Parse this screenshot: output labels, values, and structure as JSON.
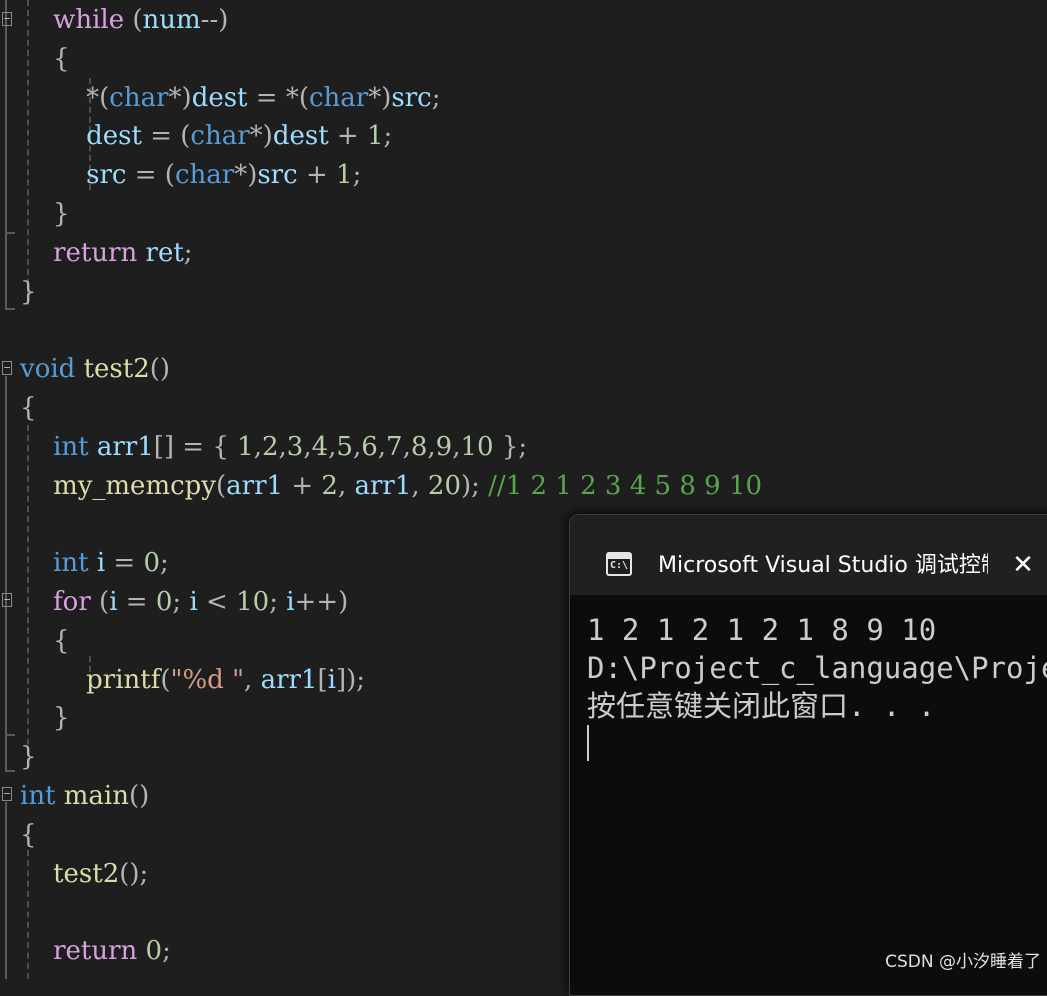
{
  "editor": {
    "lines": [
      [
        {
          "t": "    ",
          "c": "txt"
        },
        {
          "t": "while",
          "c": "ctl"
        },
        {
          "t": " (",
          "c": "pun"
        },
        {
          "t": "num",
          "c": "var"
        },
        {
          "t": "--)",
          "c": "pun"
        }
      ],
      [
        {
          "t": "    {",
          "c": "pun"
        }
      ],
      [
        {
          "t": "        ",
          "c": "txt"
        },
        {
          "t": "*(",
          "c": "pun"
        },
        {
          "t": "char",
          "c": "kw"
        },
        {
          "t": "*)",
          "c": "pun"
        },
        {
          "t": "dest",
          "c": "var"
        },
        {
          "t": " = ",
          "c": "pun"
        },
        {
          "t": "*(",
          "c": "pun"
        },
        {
          "t": "char",
          "c": "kw"
        },
        {
          "t": "*)",
          "c": "pun"
        },
        {
          "t": "src",
          "c": "var"
        },
        {
          "t": ";",
          "c": "pun"
        }
      ],
      [
        {
          "t": "        ",
          "c": "txt"
        },
        {
          "t": "dest",
          "c": "var"
        },
        {
          "t": " = (",
          "c": "pun"
        },
        {
          "t": "char",
          "c": "kw"
        },
        {
          "t": "*)",
          "c": "pun"
        },
        {
          "t": "dest",
          "c": "var"
        },
        {
          "t": " + ",
          "c": "pun"
        },
        {
          "t": "1",
          "c": "num"
        },
        {
          "t": ";",
          "c": "pun"
        }
      ],
      [
        {
          "t": "        ",
          "c": "txt"
        },
        {
          "t": "src",
          "c": "var"
        },
        {
          "t": " = (",
          "c": "pun"
        },
        {
          "t": "char",
          "c": "kw"
        },
        {
          "t": "*)",
          "c": "pun"
        },
        {
          "t": "src",
          "c": "var"
        },
        {
          "t": " + ",
          "c": "pun"
        },
        {
          "t": "1",
          "c": "num"
        },
        {
          "t": ";",
          "c": "pun"
        }
      ],
      [
        {
          "t": "    }",
          "c": "pun"
        }
      ],
      [
        {
          "t": "    ",
          "c": "txt"
        },
        {
          "t": "return",
          "c": "ctl"
        },
        {
          "t": " ",
          "c": "txt"
        },
        {
          "t": "ret",
          "c": "var"
        },
        {
          "t": ";",
          "c": "pun"
        }
      ],
      [
        {
          "t": "}",
          "c": "pun"
        }
      ],
      [],
      [
        {
          "t": "void",
          "c": "kw"
        },
        {
          "t": " ",
          "c": "txt"
        },
        {
          "t": "test2",
          "c": "fn"
        },
        {
          "t": "()",
          "c": "pun"
        }
      ],
      [
        {
          "t": "{",
          "c": "pun"
        }
      ],
      [
        {
          "t": "    ",
          "c": "txt"
        },
        {
          "t": "int",
          "c": "kw"
        },
        {
          "t": " ",
          "c": "txt"
        },
        {
          "t": "arr1",
          "c": "var"
        },
        {
          "t": "[] = { ",
          "c": "pun"
        },
        {
          "t": "1",
          "c": "num"
        },
        {
          "t": ",",
          "c": "pun"
        },
        {
          "t": "2",
          "c": "num"
        },
        {
          "t": ",",
          "c": "pun"
        },
        {
          "t": "3",
          "c": "num"
        },
        {
          "t": ",",
          "c": "pun"
        },
        {
          "t": "4",
          "c": "num"
        },
        {
          "t": ",",
          "c": "pun"
        },
        {
          "t": "5",
          "c": "num"
        },
        {
          "t": ",",
          "c": "pun"
        },
        {
          "t": "6",
          "c": "num"
        },
        {
          "t": ",",
          "c": "pun"
        },
        {
          "t": "7",
          "c": "num"
        },
        {
          "t": ",",
          "c": "pun"
        },
        {
          "t": "8",
          "c": "num"
        },
        {
          "t": ",",
          "c": "pun"
        },
        {
          "t": "9",
          "c": "num"
        },
        {
          "t": ",",
          "c": "pun"
        },
        {
          "t": "10",
          "c": "num"
        },
        {
          "t": " };",
          "c": "pun"
        }
      ],
      [
        {
          "t": "    ",
          "c": "txt"
        },
        {
          "t": "my_memcpy",
          "c": "fn"
        },
        {
          "t": "(",
          "c": "pun"
        },
        {
          "t": "arr1",
          "c": "var"
        },
        {
          "t": " + ",
          "c": "pun"
        },
        {
          "t": "2",
          "c": "num"
        },
        {
          "t": ", ",
          "c": "pun"
        },
        {
          "t": "arr1",
          "c": "var"
        },
        {
          "t": ", ",
          "c": "pun"
        },
        {
          "t": "20",
          "c": "num"
        },
        {
          "t": "); ",
          "c": "pun"
        },
        {
          "t": "//1 2 1 2 3 4 5 8 9 10",
          "c": "cmt"
        }
      ],
      [],
      [
        {
          "t": "    ",
          "c": "txt"
        },
        {
          "t": "int",
          "c": "kw"
        },
        {
          "t": " ",
          "c": "txt"
        },
        {
          "t": "i",
          "c": "var"
        },
        {
          "t": " = ",
          "c": "pun"
        },
        {
          "t": "0",
          "c": "num"
        },
        {
          "t": ";",
          "c": "pun"
        }
      ],
      [
        {
          "t": "    ",
          "c": "txt"
        },
        {
          "t": "for",
          "c": "ctl"
        },
        {
          "t": " (",
          "c": "pun"
        },
        {
          "t": "i",
          "c": "var"
        },
        {
          "t": " = ",
          "c": "pun"
        },
        {
          "t": "0",
          "c": "num"
        },
        {
          "t": "; ",
          "c": "pun"
        },
        {
          "t": "i",
          "c": "var"
        },
        {
          "t": " < ",
          "c": "pun"
        },
        {
          "t": "10",
          "c": "num"
        },
        {
          "t": "; ",
          "c": "pun"
        },
        {
          "t": "i",
          "c": "var"
        },
        {
          "t": "++)",
          "c": "pun"
        }
      ],
      [
        {
          "t": "    {",
          "c": "pun"
        }
      ],
      [
        {
          "t": "        ",
          "c": "txt"
        },
        {
          "t": "printf",
          "c": "fn"
        },
        {
          "t": "(",
          "c": "pun"
        },
        {
          "t": "\"%d \"",
          "c": "str"
        },
        {
          "t": ", ",
          "c": "pun"
        },
        {
          "t": "arr1",
          "c": "var"
        },
        {
          "t": "[",
          "c": "pun"
        },
        {
          "t": "i",
          "c": "var"
        },
        {
          "t": "]);",
          "c": "pun"
        }
      ],
      [
        {
          "t": "    }",
          "c": "pun"
        }
      ],
      [
        {
          "t": "}",
          "c": "pun"
        }
      ],
      [
        {
          "t": "int",
          "c": "kw"
        },
        {
          "t": " ",
          "c": "txt"
        },
        {
          "t": "main",
          "c": "fn"
        },
        {
          "t": "()",
          "c": "pun"
        }
      ],
      [
        {
          "t": "{",
          "c": "pun"
        }
      ],
      [
        {
          "t": "    ",
          "c": "txt"
        },
        {
          "t": "test2",
          "c": "fn"
        },
        {
          "t": "();",
          "c": "pun"
        }
      ],
      [],
      [
        {
          "t": "    ",
          "c": "txt"
        },
        {
          "t": "return",
          "c": "ctl"
        },
        {
          "t": " ",
          "c": "txt"
        },
        {
          "t": "0",
          "c": "num"
        },
        {
          "t": ";",
          "c": "pun"
        }
      ]
    ]
  },
  "console": {
    "title": "Microsoft Visual Studio 调试控制台",
    "close_icon": "close-icon",
    "output_line_1": "1 2 1 2 1 2 1 8 9 10",
    "output_line_2": "D:\\Project_c_language\\Project",
    "output_line_3": "按任意键关闭此窗口. . ."
  },
  "watermark": "CSDN @小汐睡着了"
}
